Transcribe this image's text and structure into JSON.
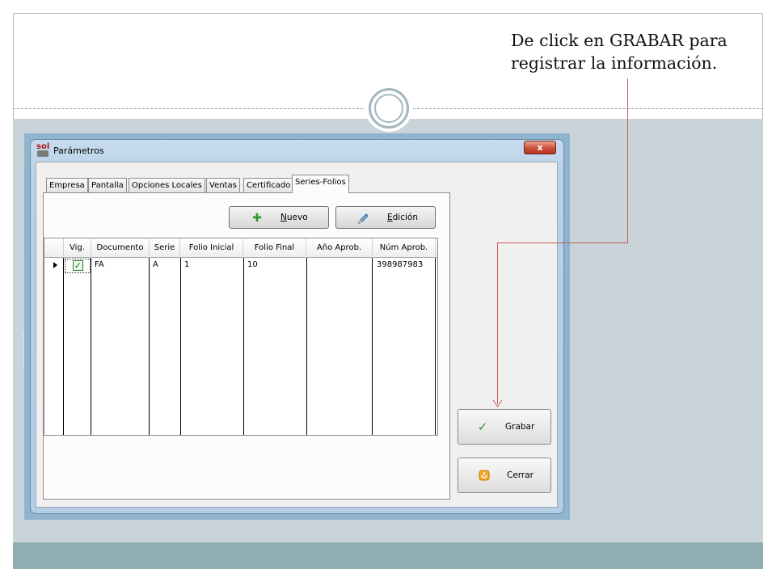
{
  "caption": {
    "line1": "De click en GRABAR para",
    "line2": "registrar la información."
  },
  "dialog": {
    "title": "Parámetros",
    "close_label": "x",
    "tabs": [
      {
        "label": "Empresa",
        "active": false
      },
      {
        "label": "Pantalla",
        "active": false
      },
      {
        "label": "Opciones Locales",
        "active": false
      },
      {
        "label": "Ventas",
        "active": false
      },
      {
        "label": "Certificado",
        "active": false
      },
      {
        "label": "Series-Folios",
        "active": true
      }
    ],
    "toolbar": {
      "nuevo_label": "Nuevo",
      "edicion_label": "Edición"
    },
    "grid": {
      "columns": [
        "Vig.",
        "Documento",
        "Serie",
        "Folio Inicial",
        "Folio Final",
        "Año Aprob.",
        "Núm Aprob."
      ],
      "rows": [
        {
          "vig": true,
          "documento": "FA",
          "serie": "A",
          "folio_inicial": "1",
          "folio_final": "10",
          "anio_aprob": "",
          "num_aprob": "398987983"
        }
      ]
    },
    "actions": {
      "grabar_label": "Grabar",
      "cerrar_label": "Cerrar"
    }
  },
  "colors": {
    "annotation_arrow": "#c65c52",
    "slide_background": "#c8d3da",
    "slide_footer": "#8eaeb1",
    "check_green": "#1e7c1e"
  },
  "icons": {
    "app_icon": "sol-app-icon",
    "nuevo_icon": "plus-icon",
    "edicion_icon": "pencil-icon",
    "grabar_icon": "checkmark-icon",
    "cerrar_icon": "exit-icon"
  }
}
